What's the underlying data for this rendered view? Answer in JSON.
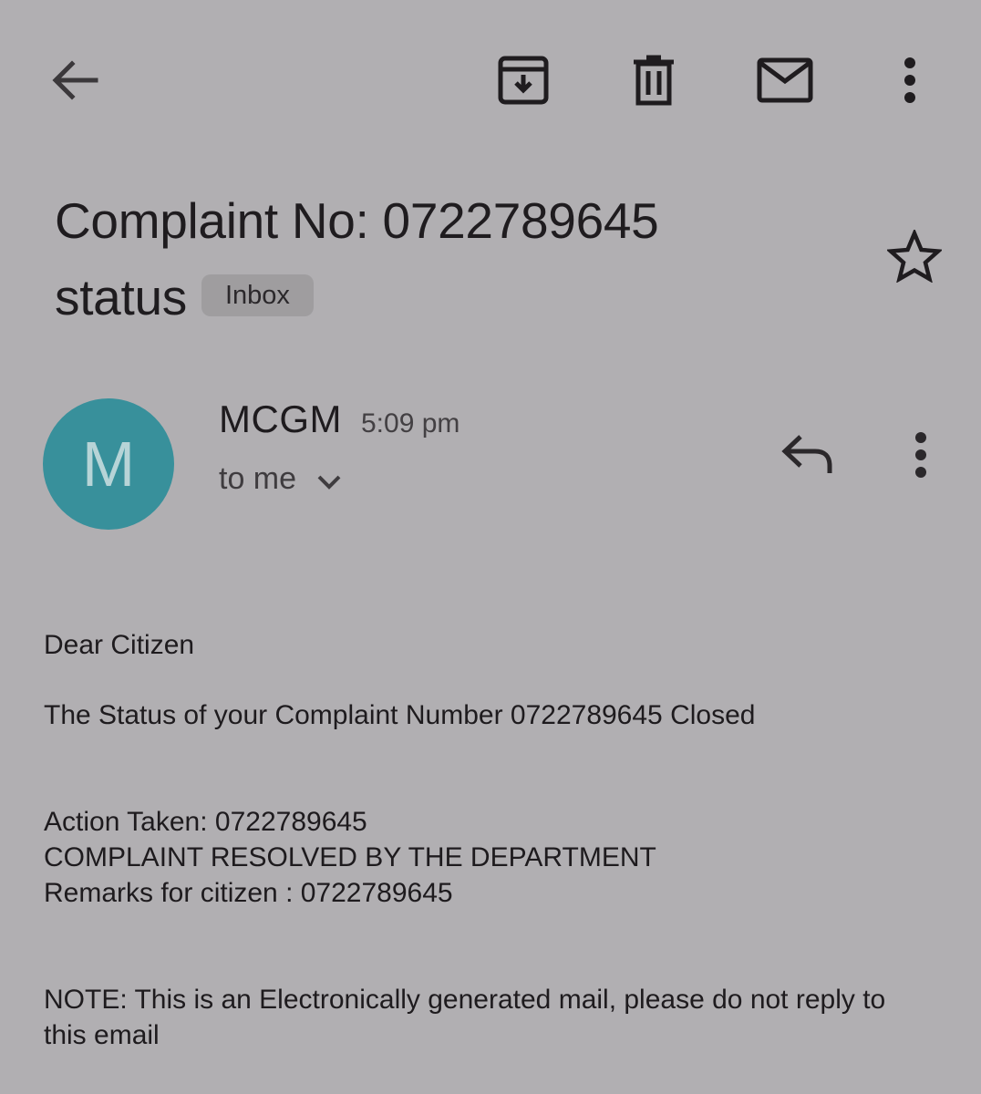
{
  "toolbar": {
    "back_icon": "arrow-left-icon",
    "archive_icon": "archive-icon",
    "delete_icon": "trash-icon",
    "mark_unread_icon": "mail-icon",
    "more_icon": "more-vert-icon"
  },
  "email": {
    "subject_line1": "Complaint No: 0722789645",
    "subject_line2": "status",
    "label": "Inbox",
    "star_icon": "star-outline-icon"
  },
  "sender": {
    "avatar_letter": "M",
    "avatar_color": "#38909b",
    "name": "MCGM",
    "time": "5:09 pm",
    "recipient": "to me",
    "reply_icon": "reply-icon",
    "more_icon": "more-vert-icon"
  },
  "body": {
    "greeting": "Dear Citizen",
    "status_line": "The Status of your Complaint Number 0722789645 Closed",
    "action_taken": "Action Taken: 0722789645",
    "resolution": "COMPLAINT RESOLVED BY THE DEPARTMENT",
    "remarks": "Remarks for citizen : 0722789645",
    "note": "NOTE: This is an Electronically generated mail, please do not reply to this email"
  },
  "colors": {
    "background": "#b1afb2",
    "text": "#201d20",
    "chip": "#9f9d9f"
  }
}
